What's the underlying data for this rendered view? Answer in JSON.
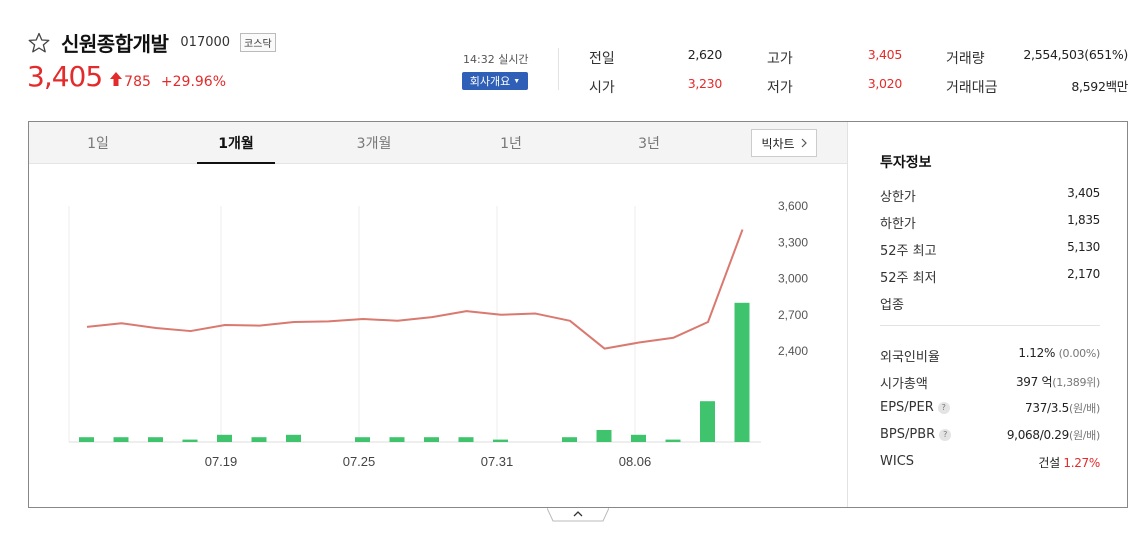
{
  "stock": {
    "name": "신원종합개발",
    "code": "017000",
    "market": "코스닥",
    "price": "3,405",
    "change": "785",
    "change_rate": "+29.96%"
  },
  "status": {
    "realtime": "14:32 실시간",
    "company_button": "회사개요"
  },
  "summary": {
    "prev_close_label": "전일",
    "prev_close": "2,620",
    "open_label": "시가",
    "open": "3,230",
    "high_label": "고가",
    "high": "3,405",
    "low_label": "저가",
    "low": "3,020",
    "volume_label": "거래량",
    "volume": "2,554,503(651%)",
    "amount_label": "거래대금",
    "amount": "8,592백만"
  },
  "tabs": [
    "1일",
    "1개월",
    "3개월",
    "1년",
    "3년"
  ],
  "active_tab": "1개월",
  "bigchart_label": "빅차트",
  "invest": {
    "title": "투자정보",
    "upper_limit_label": "상한가",
    "upper_limit": "3,405",
    "lower_limit_label": "하한가",
    "lower_limit": "1,835",
    "high52_label": "52주 최고",
    "high52": "5,130",
    "low52_label": "52주 최저",
    "low52": "2,170",
    "industry_label": "업종",
    "foreign_label": "외국인비율",
    "foreign": "1.12%",
    "foreign_sub": "(0.00%)",
    "mcap_label": "시가총액",
    "mcap": "397 억",
    "mcap_sub": "(1,389위)",
    "eps_per_label": "EPS/PER",
    "eps_per": "737/3.5",
    "eps_per_sub": "(원/배)",
    "bps_pbr_label": "BPS/PBR",
    "bps_pbr": "9,068/0.29",
    "bps_pbr_sub": "(원/배)",
    "wics_label": "WICS",
    "wics": "건설",
    "wics_rate": "1.27%"
  },
  "colors": {
    "up": "#e32b2b",
    "down": "#2e5fcf",
    "price_line": "#d9796f",
    "volume_bar": "#3fc46d",
    "accent_button": "#2f5fb6"
  },
  "chart_data": {
    "type": "line",
    "price": [
      2600,
      2630,
      2590,
      2565,
      2615,
      2610,
      2640,
      2645,
      2665,
      2650,
      2680,
      2730,
      2700,
      2710,
      2650,
      2420,
      2470,
      2510,
      2640,
      3405
    ],
    "volume": [
      0.02,
      0.02,
      0.02,
      0.01,
      0.03,
      0.02,
      0.03,
      0.0,
      0.02,
      0.02,
      0.02,
      0.02,
      0.01,
      0.0,
      0.02,
      0.05,
      0.03,
      0.01,
      0.17,
      0.58
    ],
    "y_ticks": [
      "3,600",
      "3,300",
      "3,000",
      "2,700",
      "2,400"
    ],
    "y_tick_values": [
      3600,
      3300,
      3000,
      2700,
      2400
    ],
    "x_ticks": [
      "07.19",
      "07.25",
      "07.31",
      "08.06"
    ],
    "x_tick_index": [
      4,
      8,
      12,
      16
    ],
    "ylim": [
      2200,
      3600
    ]
  }
}
